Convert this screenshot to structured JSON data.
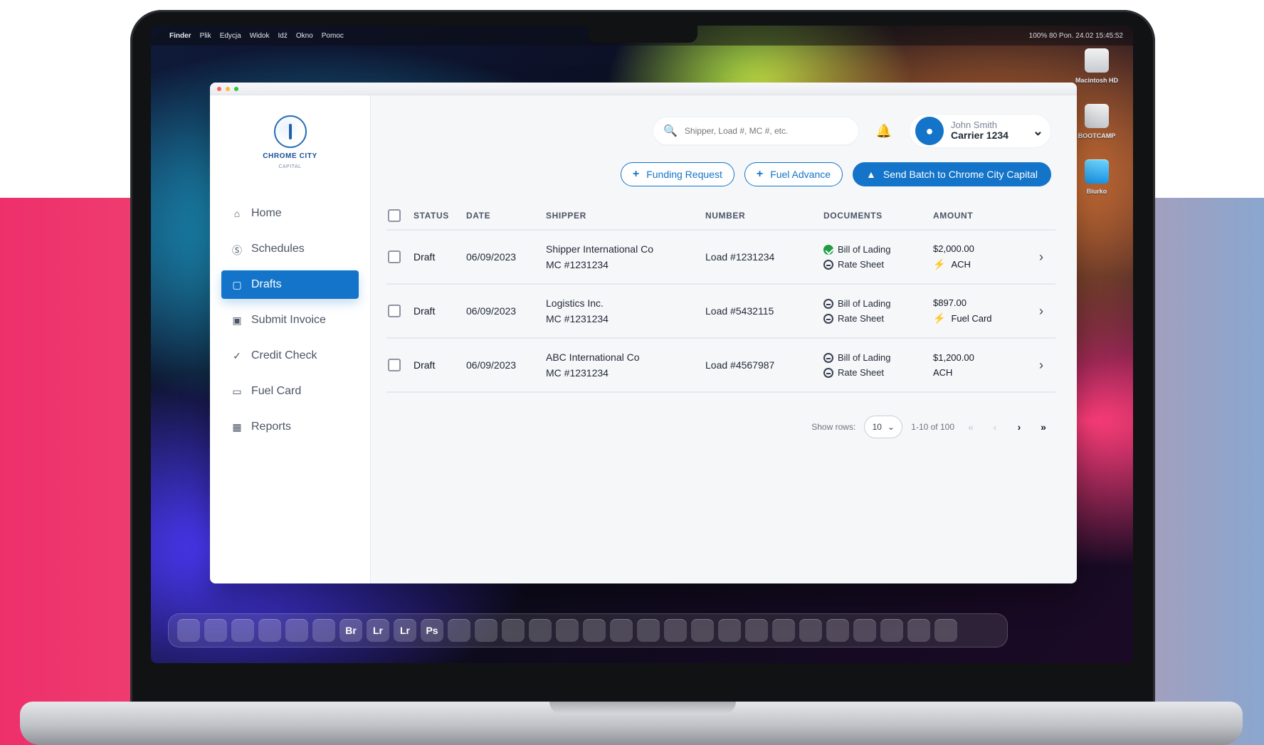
{
  "macos": {
    "menubar": {
      "apple": "",
      "app": "Finder",
      "menus": [
        "Plik",
        "Edycja",
        "Widok",
        "Idź",
        "Okno",
        "Pomoc"
      ],
      "status_right": "100% 80  Pon. 24.02  15:45:52"
    },
    "desktop_items": [
      {
        "label": "Macintosh HD",
        "icon": "drive-icon"
      },
      {
        "label": "BOOTCAMP",
        "icon": "drive-icon"
      },
      {
        "label": "Biurko",
        "icon": "folder-icon"
      }
    ],
    "dock": {
      "items": [
        "Br",
        "Lr",
        "Lr",
        "Ps"
      ]
    }
  },
  "app": {
    "logo": {
      "brand": "CHROME CITY",
      "subbrand": "CAPITAL"
    },
    "nav": [
      {
        "label": "Home",
        "icon": "home-icon",
        "active": false
      },
      {
        "label": "Schedules",
        "icon": "dollar-icon",
        "active": false
      },
      {
        "label": "Drafts",
        "icon": "doc-icon",
        "active": true
      },
      {
        "label": "Submit Invoice",
        "icon": "invoice-icon",
        "active": false
      },
      {
        "label": "Credit Check",
        "icon": "check-icon",
        "active": false
      },
      {
        "label": "Fuel Card",
        "icon": "card-icon",
        "active": false
      },
      {
        "label": "Reports",
        "icon": "reports-icon",
        "active": false
      }
    ],
    "search": {
      "placeholder": "Shipper, Load #, MC #, etc."
    },
    "user": {
      "name": "John Smith",
      "sub": "Carrier 1234"
    },
    "actions": {
      "funding_request": "Funding Request",
      "fuel_advance": "Fuel Advance",
      "send_batch": "Send Batch to Chrome City Capital"
    },
    "table": {
      "headers": {
        "status": "STATUS",
        "date": "DATE",
        "shipper": "SHIPPER",
        "number": "NUMBER",
        "documents": "DOCUMENTS",
        "amount": "AMOUNT"
      },
      "rows": [
        {
          "status": "Draft",
          "date": "06/09/2023",
          "shipper_name": "Shipper International Co",
          "shipper_mc": "MC #1231234",
          "number": "Load #1231234",
          "doc1": "Bill of Lading",
          "doc2": "Rate Sheet",
          "amount": "$2,000.00",
          "payment": "ACH"
        },
        {
          "status": "Draft",
          "date": "06/09/2023",
          "shipper_name": "Logistics Inc.",
          "shipper_mc": "MC #1231234",
          "number": "Load #5432115",
          "doc1": "Bill of Lading",
          "doc2": "Rate Sheet",
          "amount": "$897.00",
          "payment": "Fuel Card"
        },
        {
          "status": "Draft",
          "date": "06/09/2023",
          "shipper_name": "ABC International Co",
          "shipper_mc": "MC #1231234",
          "number": "Load #4567987",
          "doc1": "Bill of Lading",
          "doc2": "Rate Sheet",
          "amount": "$1,200.00",
          "payment": "ACH"
        }
      ]
    },
    "pagination": {
      "show_rows_label": "Show rows:",
      "rows_value": "10",
      "range_text": "1-10 of 100"
    }
  }
}
